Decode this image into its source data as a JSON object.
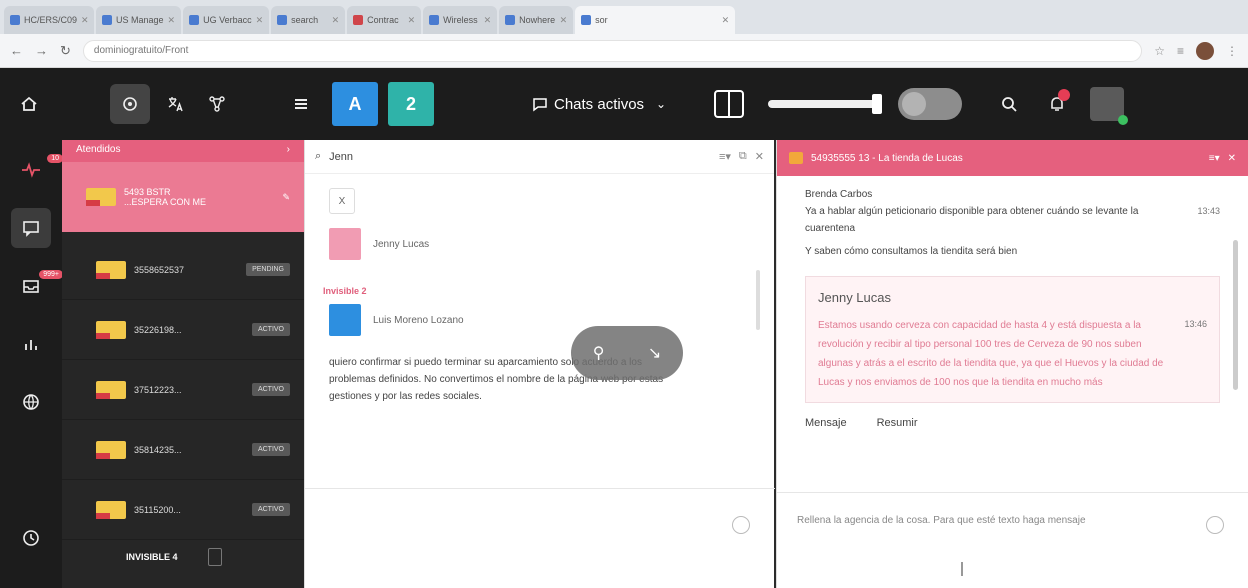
{
  "browser": {
    "tabs": [
      {
        "label": "HC/ERS/C09",
        "icon": "page-icon"
      },
      {
        "label": "US Manage",
        "icon": "page-icon"
      },
      {
        "label": "UG Verbacc",
        "icon": "page-icon"
      },
      {
        "label": "search",
        "icon": "page-icon"
      },
      {
        "label": "Contrac",
        "icon": "page-icon"
      },
      {
        "label": "Wireless",
        "icon": "page-icon"
      },
      {
        "label": "Nowhere",
        "icon": "page-icon"
      },
      {
        "label": "sor",
        "icon": "page-icon",
        "active": true
      }
    ],
    "url": "dominiogratuito/Front"
  },
  "header": {
    "workspace_a": "A",
    "workspace_2": "2",
    "chat_filter_label": "Chats activos",
    "accent_color": "#e5607e"
  },
  "rail": {
    "items": [
      {
        "icon": "pulse-icon",
        "badge": "10"
      },
      {
        "icon": "chat-icon",
        "badge": ""
      },
      {
        "icon": "inbox-icon",
        "badge": "999+"
      },
      {
        "icon": "chart-icon",
        "badge": ""
      },
      {
        "icon": "globe-icon",
        "badge": ""
      },
      {
        "icon": "clock-icon",
        "badge": ""
      }
    ]
  },
  "queue": {
    "header": "Atendidos",
    "active_item": {
      "line1": "5493 BSTR",
      "line2": "...ESPERA CON ME"
    },
    "items": [
      {
        "name": "3558652537",
        "status": "PENDING"
      },
      {
        "name": "35226198...",
        "status": "ACTIVO"
      },
      {
        "name": "37512223...",
        "status": "ACTIVO"
      },
      {
        "name": "35814235...",
        "status": "ACTIVO"
      },
      {
        "name": "35115200...",
        "status": "ACTIVO"
      }
    ],
    "footer_label": "INVISIBLE 4"
  },
  "middle": {
    "search_value": "Jenn",
    "sub_value": "X",
    "contact_1": "Jenny Lucas",
    "group_label": "Invisible 2",
    "contact_2": "Luis Moreno Lozano",
    "message": "quiero confirmar si puedo terminar su aparcamiento solo acuerdo a los problemas definidos. No convertimos el nombre de la página web por estas gestiones y por las redes sociales."
  },
  "right": {
    "header_title": "54935555 13 - La tienda de Lucas",
    "sender": "Brenda Carbos",
    "message_1": "Ya a hablar algún peticionario disponible para obtener cuándo se levante la cuarentena",
    "time_1": "13:43",
    "message_2": "Y saben cómo consultamos la tiendita será bien",
    "quote_name": "Jenny Lucas",
    "quote_text": "Estamos usando cerveza con capacidad de hasta 4 y está dispuesta a la revolución y recibir al tipo personal 100 tres de Cerveza de 90 nos suben algunas y atrás a el escrito de la tiendita que, ya que el Huevos y la ciudad de Lucas y nos enviamos de 100 nos que la tiendita en mucho más",
    "quote_time": "13:46",
    "action_1": "Mensaje",
    "action_2": "Resumir",
    "compose_placeholder": "Rellena la agencia de la cosa. Para que esté texto haga mensaje"
  }
}
